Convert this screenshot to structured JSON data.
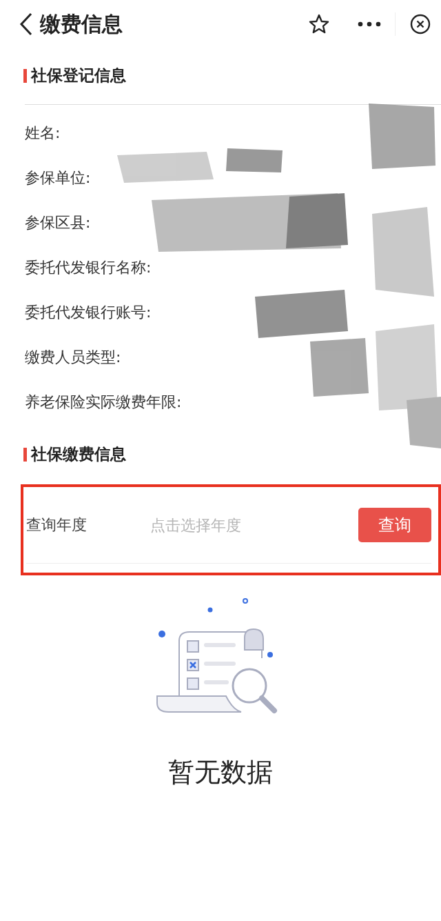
{
  "header": {
    "title": "缴费信息"
  },
  "registration": {
    "title": "社保登记信息",
    "fields": [
      {
        "label": "姓名:"
      },
      {
        "label": "参保单位:"
      },
      {
        "label": "参保区县:"
      },
      {
        "label": "委托代发银行名称:"
      },
      {
        "label": "委托代发银行账号:"
      },
      {
        "label": "缴费人员类型:"
      },
      {
        "label": "养老保险实际缴费年限:"
      }
    ]
  },
  "payment": {
    "title": "社保缴费信息",
    "query": {
      "label": "查询年度",
      "placeholder": "点击选择年度",
      "button": "查询"
    }
  },
  "empty_state": {
    "text": "暂无数据"
  }
}
